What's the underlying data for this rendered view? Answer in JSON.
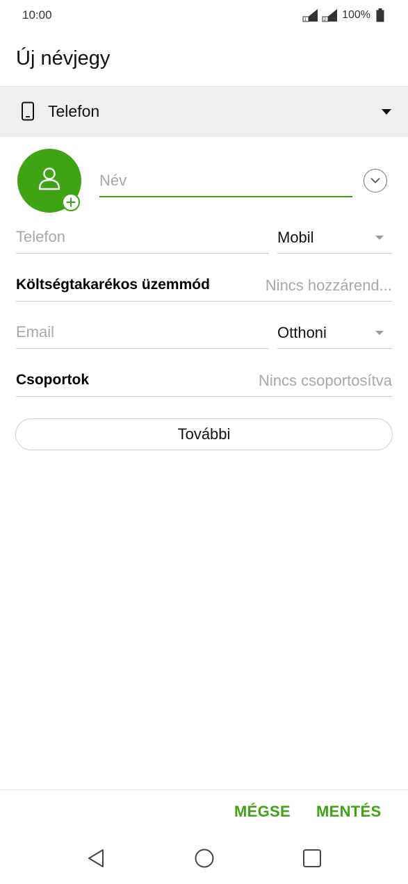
{
  "status_bar": {
    "time": "10:00",
    "battery": "100%"
  },
  "header": {
    "title": "Új névjegy"
  },
  "account": {
    "label": "Telefon"
  },
  "form": {
    "name_placeholder": "Név",
    "phone_placeholder": "Telefon",
    "phone_type": "Mobil",
    "saver_label": "Költségtakarékos üzemmód",
    "saver_value": "Nincs hozzárend...",
    "email_placeholder": "Email",
    "email_type": "Otthoni",
    "groups_label": "Csoportok",
    "groups_value": "Nincs csoportosítva",
    "more_label": "További"
  },
  "actions": {
    "cancel": "MÉGSE",
    "save": "MENTÉS"
  },
  "colors": {
    "accent": "#3fa413",
    "account_bar": "#efefef"
  },
  "icons": [
    "signal-1-icon",
    "signal-2-icon",
    "battery-icon",
    "phone-icon",
    "dropdown-caret-icon",
    "person-icon",
    "add-photo-icon",
    "expand-icon",
    "back-nav-icon",
    "home-nav-icon",
    "recents-nav-icon"
  ]
}
